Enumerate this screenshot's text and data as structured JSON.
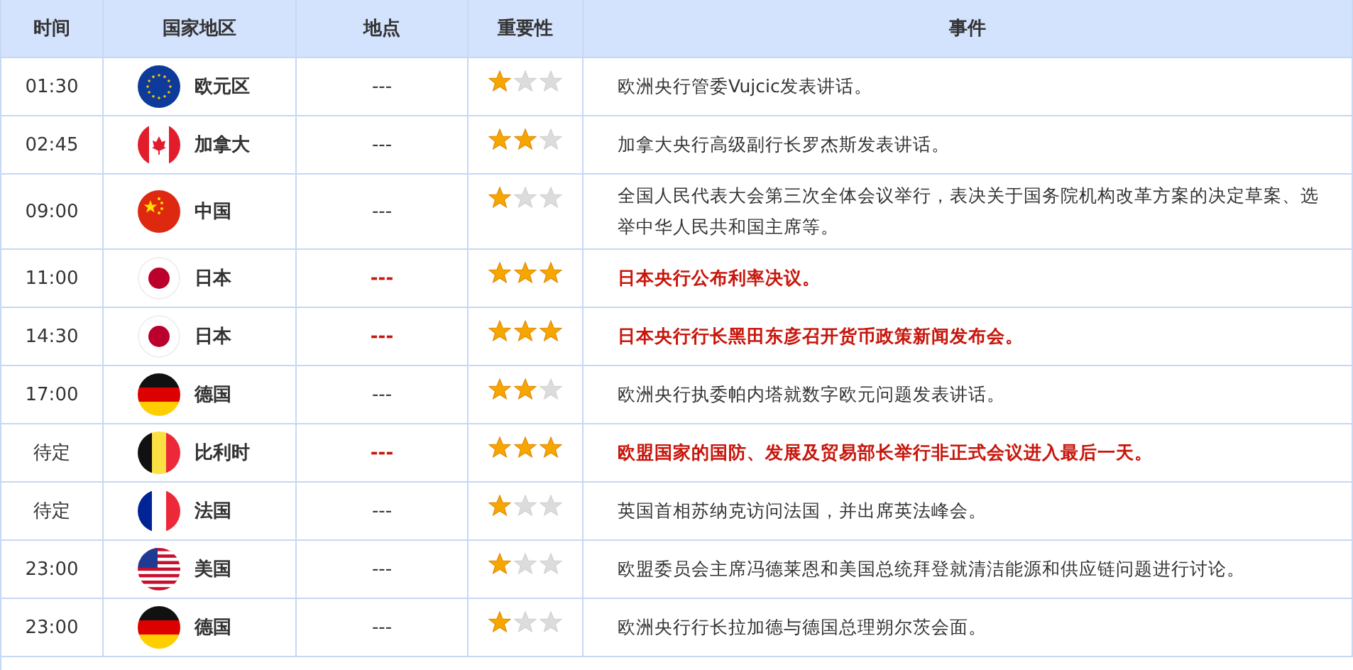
{
  "table": {
    "columns": [
      "时间",
      "国家地区",
      "地点",
      "重要性",
      "事件"
    ],
    "rows": [
      {
        "time": "01:30",
        "kind": "eu",
        "country": "欧元区",
        "place": "---",
        "stars": 1,
        "important": false,
        "event": "欧洲央行管委Vujcic发表讲话。"
      },
      {
        "time": "02:45",
        "kind": "ca",
        "country": "加拿大",
        "place": "---",
        "stars": 2,
        "important": false,
        "event": "加拿大央行高级副行长罗杰斯发表讲话。"
      },
      {
        "time": "09:00",
        "kind": "cn",
        "country": "中国",
        "place": "---",
        "stars": 1,
        "important": false,
        "event": "全国人民代表大会第三次全体会议举行，表决关于国务院机构改革方案的决定草案、选举中华人民共和国主席等。"
      },
      {
        "time": "11:00",
        "kind": "jp",
        "country": "日本",
        "place": "---",
        "stars": 3,
        "important": true,
        "event": "日本央行公布利率决议。"
      },
      {
        "time": "14:30",
        "kind": "jp",
        "country": "日本",
        "place": "---",
        "stars": 3,
        "important": true,
        "event": "日本央行行长黑田东彦召开货币政策新闻发布会。"
      },
      {
        "time": "17:00",
        "kind": "de",
        "country": "德国",
        "place": "---",
        "stars": 2,
        "important": false,
        "event": "欧洲央行执委帕内塔就数字欧元问题发表讲话。"
      },
      {
        "time": "待定",
        "kind": "be",
        "country": "比利时",
        "place": "---",
        "stars": 3,
        "important": true,
        "event": "欧盟国家的国防、发展及贸易部长举行非正式会议进入最后一天。"
      },
      {
        "time": "待定",
        "kind": "fr",
        "country": "法国",
        "place": "---",
        "stars": 1,
        "important": false,
        "event": "英国首相苏纳克访问法国，并出席英法峰会。"
      },
      {
        "time": "23:00",
        "kind": "us",
        "country": "美国",
        "place": "---",
        "stars": 1,
        "important": false,
        "event": "欧盟委员会主席冯德莱恩和美国总统拜登就清洁能源和供应链问题进行讨论。"
      },
      {
        "time": "23:00",
        "kind": "de",
        "country": "德国",
        "place": "---",
        "stars": 1,
        "important": false,
        "event": "欧洲央行行长拉加德与德国总理朔尔茨会面。"
      }
    ]
  }
}
